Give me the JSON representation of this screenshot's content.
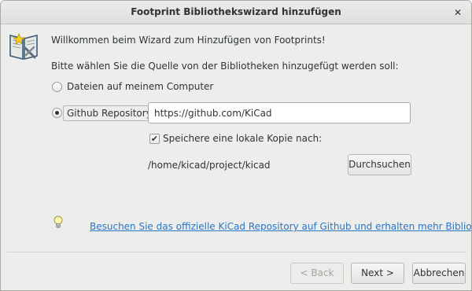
{
  "window": {
    "title": "Footprint Bibliothekswizard hinzufügen",
    "close_glyph": "✕"
  },
  "intro": {
    "welcome": "Willkommen beim Wizard zum Hinzufügen von Footprints!",
    "prompt": "Bitte wählen Sie die Quelle von der Bibliotheken hinzugefügt werden soll:"
  },
  "source_options": [
    {
      "label": "Dateien auf meinem Computer",
      "selected": false
    },
    {
      "label": "Github Repository",
      "selected": true
    }
  ],
  "github": {
    "url_value": "https://github.com/KiCad",
    "save_copy": {
      "label": "Speichere eine lokale Kopie nach:",
      "checked": true,
      "check_glyph": "✔"
    },
    "local_path": "/home/kicad/project/kicad",
    "browse_label": "Durchsuchen"
  },
  "hint": {
    "icon": "lightbulb-icon",
    "link_text": "Besuchen Sie das offizielle KiCad Repository auf Github und erhalten mehr Bibliotheken"
  },
  "footer": {
    "back_label": "< Back",
    "back_enabled": false,
    "next_label": "Next >",
    "cancel_label": "Abbrechen"
  },
  "colors": {
    "link": "#2a76c6",
    "window_bg": "#ededeb"
  }
}
